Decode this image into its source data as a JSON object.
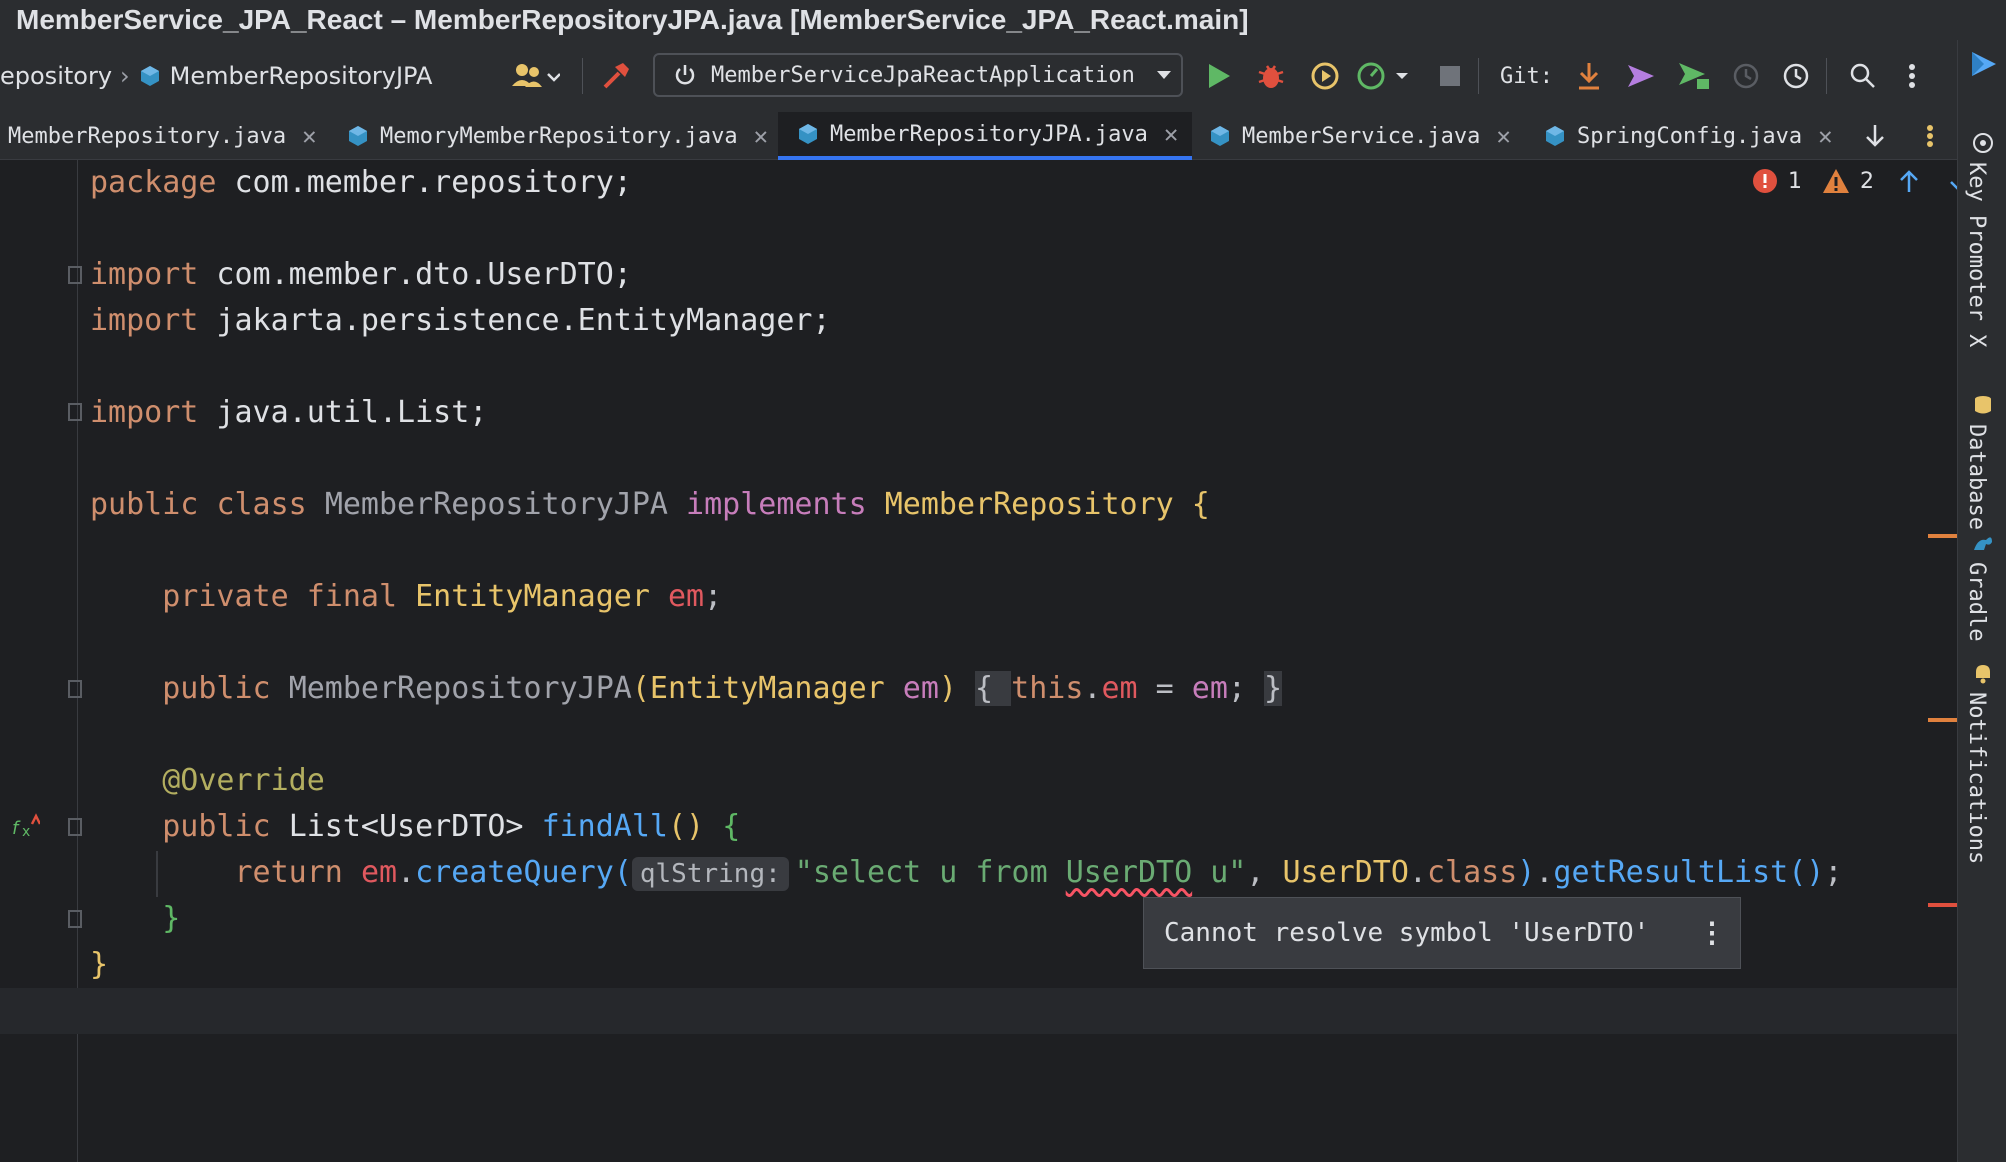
{
  "window": {
    "title": "MemberService_JPA_React – MemberRepositoryJPA.java [MemberService_JPA_React.main]"
  },
  "toolbar": {
    "breadcrumb": [
      "epository",
      "MemberRepositoryJPA"
    ],
    "run_config": "MemberServiceJpaReactApplication",
    "git_label": "Git:"
  },
  "tabs": [
    {
      "label": "MemberRepository.java",
      "active": false
    },
    {
      "label": "MemoryMemberRepository.java",
      "active": false
    },
    {
      "label": "MemberRepositoryJPA.java",
      "active": true
    },
    {
      "label": "MemberService.java",
      "active": false
    },
    {
      "label": "SpringConfig.java",
      "active": false
    }
  ],
  "inspections": {
    "errors": "1",
    "warnings": "2"
  },
  "code": {
    "package_kw": "package",
    "package_name": " com.member.repository;",
    "import_kw": "import",
    "import1": " com.member.dto.UserDTO;",
    "import2": " jakarta.persistence.EntityManager;",
    "import3": " java.util.List;",
    "public_kw": "public",
    "class_kw": "class",
    "class_name": "MemberRepositoryJPA",
    "implements_kw": "implements",
    "interface_name": "MemberRepository",
    "private_kw": "private",
    "final_kw": "final",
    "em_type": "EntityManager",
    "em_field": "em",
    "ctor_name": "MemberRepositoryJPA",
    "this_kw": "this",
    "override_ann": "@Override",
    "list_type": "List<UserDTO>",
    "method_name": "findAll",
    "return_kw": "return",
    "create_query": "createQuery",
    "param_hint": "qlString:",
    "query_str_a": "\"select u from ",
    "query_err_token": "UserDTO",
    "query_str_b": " u\"",
    "userdto_class": "UserDTO",
    "class_kw2": "class",
    "get_result": "getResultList"
  },
  "tooltip": {
    "message": "Cannot resolve symbol 'UserDTO'"
  },
  "tool_windows": [
    "Key Promoter X",
    "Database",
    "Gradle",
    "Notifications"
  ]
}
